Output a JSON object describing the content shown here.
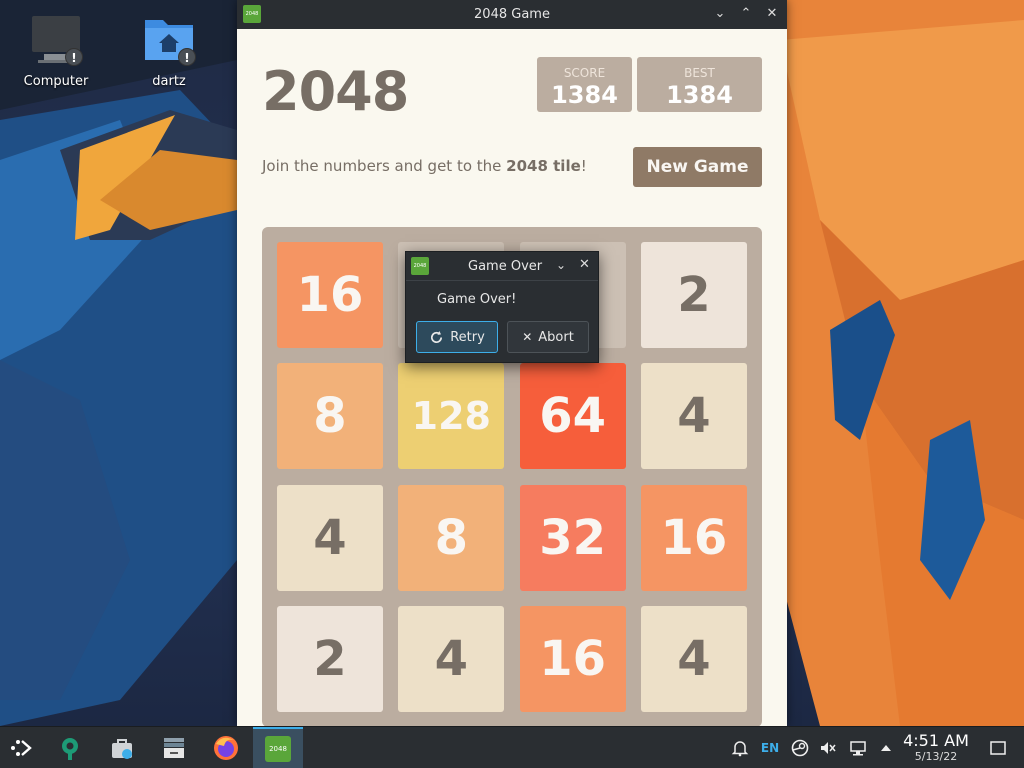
{
  "desktop": {
    "icons": [
      {
        "label": "Computer"
      },
      {
        "label": "dartz"
      }
    ]
  },
  "window": {
    "title": "2048 Game",
    "icon_text": "2048"
  },
  "game": {
    "heading": "2048",
    "score_label": "SCORE",
    "score": "1384",
    "best_label": "BEST",
    "best": "1384",
    "intro_prefix": "Join the numbers and get to the ",
    "intro_bold": "2048 tile",
    "intro_suffix": "!",
    "new_game": "New Game",
    "tiles": [
      [
        "16",
        "",
        "",
        "2"
      ],
      [
        "8",
        "128",
        "64",
        "4"
      ],
      [
        "4",
        "8",
        "32",
        "16"
      ],
      [
        "2",
        "4",
        "16",
        "4"
      ]
    ],
    "tile_colors": {
      "2": "#eee4da",
      "4": "#ede0c8",
      "8": "#f2b179",
      "16": "#f59563",
      "32": "#f67c5f",
      "64": "#f65e3b",
      "128": "#edcf72"
    }
  },
  "dialog": {
    "title": "Game Over",
    "message": "Game Over!",
    "retry": "Retry",
    "abort": "Abort"
  },
  "taskbar": {
    "keyboard_layout": "EN",
    "time": "4:51 AM",
    "date": "5/13/22",
    "active_icon_text": "2048"
  }
}
